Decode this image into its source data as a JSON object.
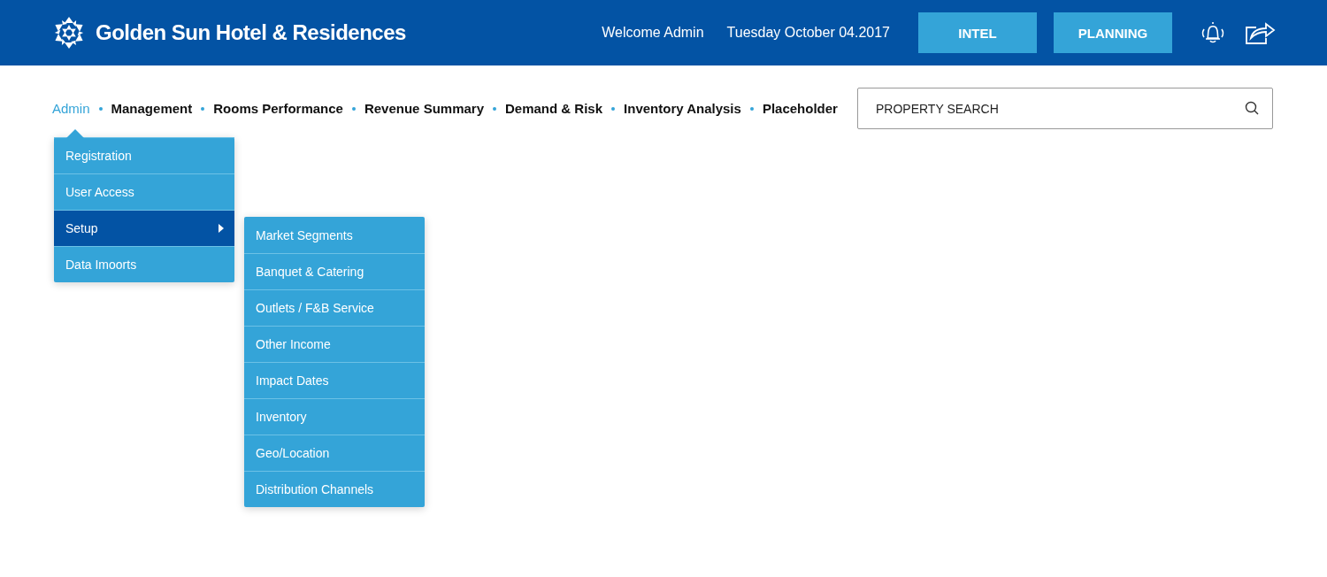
{
  "header": {
    "brand": "Golden Sun Hotel & Residences",
    "welcome": "Welcome Admin",
    "date": "Tuesday October 04.2017",
    "buttons": [
      "INTEL",
      "PLANNING"
    ]
  },
  "nav": [
    {
      "label": "Admin",
      "selected": true
    },
    {
      "label": "Management",
      "selected": false
    },
    {
      "label": "Rooms Performance",
      "selected": false
    },
    {
      "label": "Revenue Summary",
      "selected": false
    },
    {
      "label": "Demand & Risk",
      "selected": false
    },
    {
      "label": "Inventory Analysis",
      "selected": false
    },
    {
      "label": "Placeholder",
      "selected": false
    }
  ],
  "search": {
    "placeholder": "PROPERTY SEARCH"
  },
  "menu": [
    {
      "label": "Registration",
      "selected": false,
      "has_submenu": false
    },
    {
      "label": "User Access",
      "selected": false,
      "has_submenu": false
    },
    {
      "label": "Setup",
      "selected": true,
      "has_submenu": true
    },
    {
      "label": "Data Imoorts",
      "selected": false,
      "has_submenu": false
    }
  ],
  "submenu": [
    {
      "label": "Market Segments",
      "selected": false
    },
    {
      "label": "Banquet & Catering",
      "selected": false
    },
    {
      "label": "Outlets / F&B Service",
      "selected": false
    },
    {
      "label": "Other Income",
      "selected": false
    },
    {
      "label": "Impact Dates",
      "selected": false
    },
    {
      "label": "Inventory",
      "selected": false
    },
    {
      "label": "Geo/Location",
      "selected": false
    },
    {
      "label": "Distribution Channels",
      "selected": false
    }
  ]
}
